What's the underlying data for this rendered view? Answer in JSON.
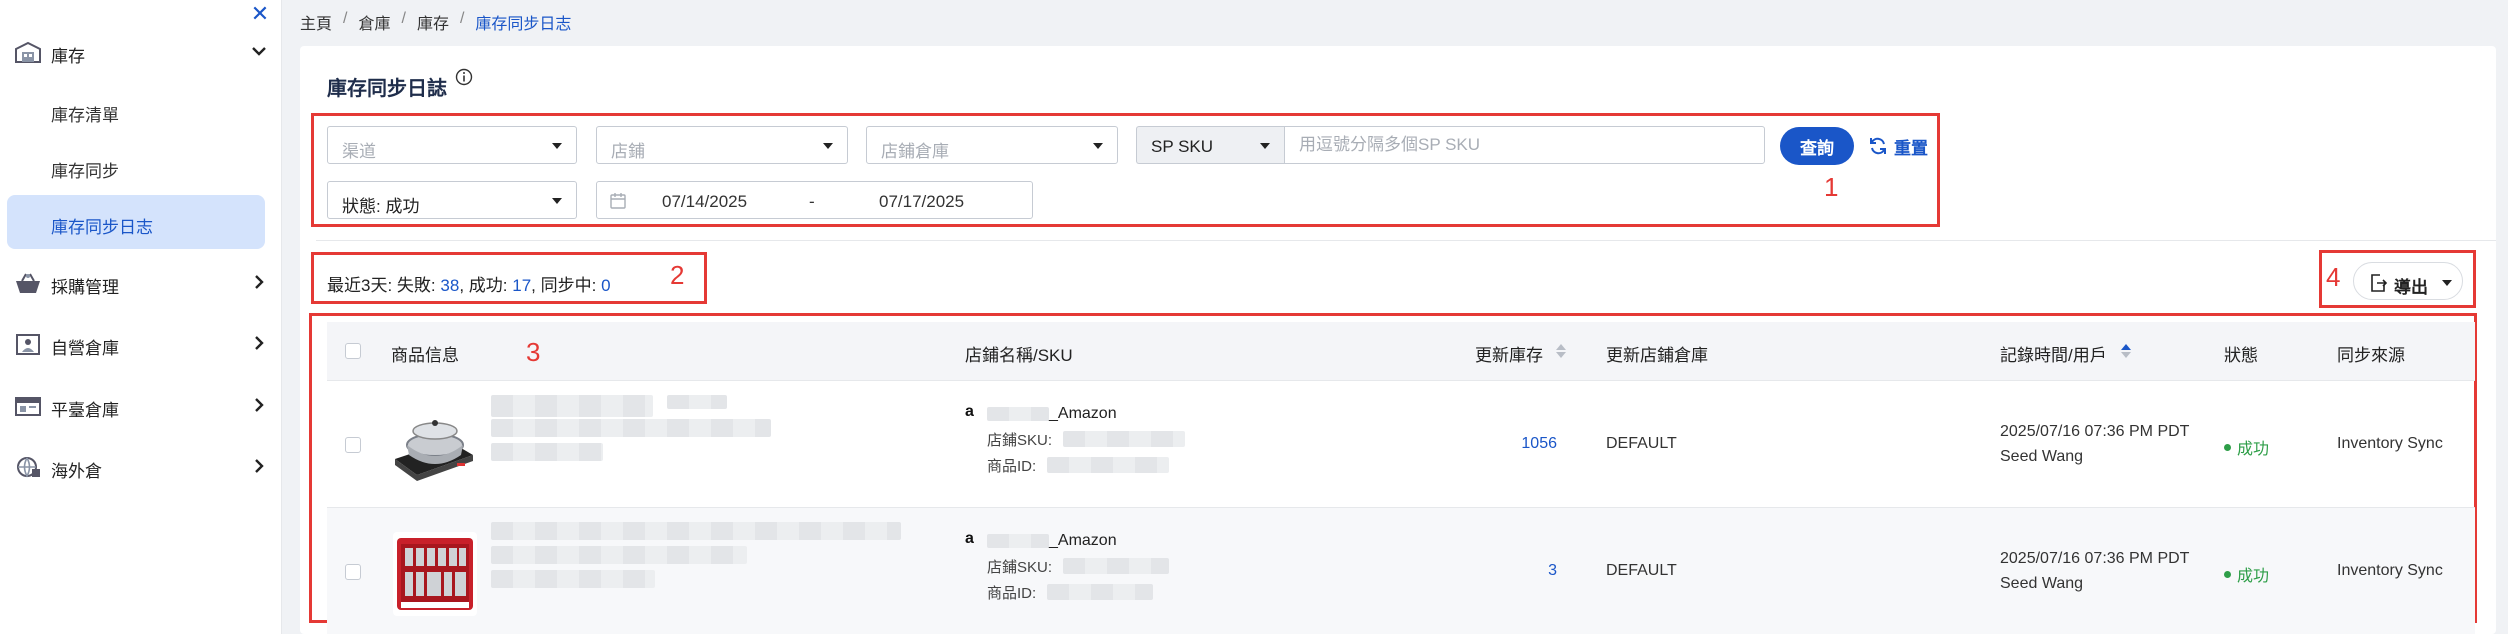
{
  "sidebar": {
    "groups": [
      {
        "label": "庫存",
        "icon": "warehouse-icon",
        "expanded": true
      },
      {
        "label": "採購管理",
        "icon": "basket-icon",
        "expanded": false
      },
      {
        "label": "自營倉庫",
        "icon": "self-warehouse-icon",
        "expanded": false
      },
      {
        "label": "平臺倉庫",
        "icon": "platform-warehouse-icon",
        "expanded": false
      },
      {
        "label": "海外倉",
        "icon": "globe-warehouse-icon",
        "expanded": false
      }
    ],
    "submenu": [
      {
        "label": "庫存清單"
      },
      {
        "label": "庫存同步"
      },
      {
        "label": "庫存同步日志",
        "active": true
      }
    ]
  },
  "breadcrumb": {
    "items": [
      "主頁",
      "倉庫",
      "庫存"
    ],
    "current": "庫存同步日志"
  },
  "page": {
    "title": "庫存同步日誌"
  },
  "filters": {
    "channel_placeholder": "渠道",
    "store_placeholder": "店鋪",
    "store_warehouse_placeholder": "店鋪倉庫",
    "sku_type": "SP SKU",
    "sku_placeholder": "用逗號分隔多個SP SKU",
    "query_label": "查詢",
    "reset_label": "重置",
    "status_value": "狀態: 成功",
    "date_start": "07/14/2025",
    "date_sep": "-",
    "date_end": "07/17/2025"
  },
  "summary": {
    "prefix": "最近3天:",
    "fail_label": "失敗:",
    "fail_count": "38",
    "success_label": "成功:",
    "success_count": "17",
    "syncing_label": "同步中:",
    "syncing_count": "0"
  },
  "export": {
    "label": "導出"
  },
  "annotations": {
    "n1": "1",
    "n2": "2",
    "n3": "3",
    "n4": "4"
  },
  "table": {
    "columns": {
      "product": "商品信息",
      "store_sku": "店鋪名稱/SKU",
      "update_stock": "更新庫存",
      "update_warehouse": "更新店鋪倉庫",
      "record_time": "記錄時間/用戶",
      "status": "狀態",
      "source": "同步來源"
    },
    "rows": [
      {
        "store_suffix": "_Amazon",
        "store_sku_label": "店鋪SKU:",
        "product_id_label": "商品ID:",
        "stock": "1056",
        "warehouse": "DEFAULT",
        "time": "2025/07/16 07:36 PM PDT",
        "user": "Seed Wang",
        "status": "成功",
        "source": "Inventory Sync"
      },
      {
        "store_suffix": "_Amazon",
        "store_sku_label": "店鋪SKU:",
        "product_id_label": "商品ID:",
        "stock": "3",
        "warehouse": "DEFAULT",
        "time": "2025/07/16 07:36 PM PDT",
        "user": "Seed Wang",
        "status": "成功",
        "source": "Inventory Sync"
      }
    ]
  },
  "colors": {
    "accent": "#1a56c8",
    "annotation_red": "#e53935",
    "success": "#2e9e48",
    "active_bg": "#d4e3fc"
  }
}
